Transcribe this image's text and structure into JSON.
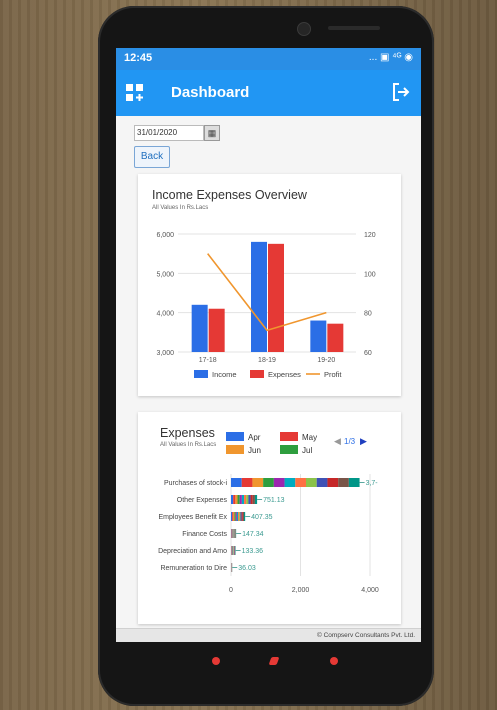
{
  "status": {
    "time": "12:45",
    "icons": "... ▣ ⁴ᴳ ◉"
  },
  "appbar": {
    "title": "Dashboard"
  },
  "filter": {
    "date": "31/01/2020",
    "back_label": "Back"
  },
  "card1": {
    "title": "Income Expenses Overview",
    "subtitle": "All Values In Rs.Lacs"
  },
  "card2": {
    "title": "Expenses",
    "subtitle": "All Values In Rs.Lacs",
    "page": "1/3"
  },
  "footer": {
    "text": "© Compserv Consultants Pvt. Ltd."
  },
  "chart_data": [
    {
      "type": "bar",
      "categories": [
        "17-18",
        "18-19",
        "19-20"
      ],
      "series": [
        {
          "name": "Income",
          "values": [
            4200,
            5800,
            3800
          ],
          "color": "#2b6ee6"
        },
        {
          "name": "Expenses",
          "values": [
            4100,
            5750,
            3720
          ],
          "color": "#e53935"
        }
      ],
      "line_series": {
        "name": "Profit",
        "values": [
          110,
          71,
          80
        ],
        "color": "#f0962e"
      },
      "ylim": [
        3000,
        6000
      ],
      "y_ticks": [
        "3,000",
        "4,000",
        "5,000",
        "6,000"
      ],
      "y2lim": [
        60,
        120
      ],
      "y2_ticks": [
        "60",
        "80",
        "100",
        "120"
      ],
      "grid": true,
      "legend": "bottom"
    },
    {
      "type": "bar",
      "orientation": "horizontal",
      "stacked": true,
      "categories": [
        "Purchases of stock-i",
        "Other Expenses",
        "Employees Benefit Ex",
        "Finance Costs",
        "Depreciation and Amo",
        "Remuneration to Dire"
      ],
      "totals": [
        3700,
        751.13,
        407.35,
        147.34,
        133.36,
        36.03
      ],
      "total_labels": [
        "3,7-",
        "751.13",
        "407.35",
        "147.34",
        "133.36",
        "36.03"
      ],
      "legend_items": [
        {
          "name": "Apr",
          "color": "#2b6ee6"
        },
        {
          "name": "May",
          "color": "#e53935"
        },
        {
          "name": "Jun",
          "color": "#f0962e"
        },
        {
          "name": "Jul",
          "color": "#2e9e3e"
        }
      ],
      "segment_colors": [
        "#2b6ee6",
        "#e53935",
        "#f0962e",
        "#2e9e3e",
        "#9c27b0",
        "#00acc1",
        "#ff7043",
        "#8bc34a",
        "#3f51b5",
        "#c62828",
        "#795548",
        "#009688"
      ],
      "x_ticks": [
        "0",
        "2,000",
        "4,000"
      ],
      "xlim": [
        0,
        4000
      ],
      "grid": true,
      "legend": "top"
    }
  ]
}
